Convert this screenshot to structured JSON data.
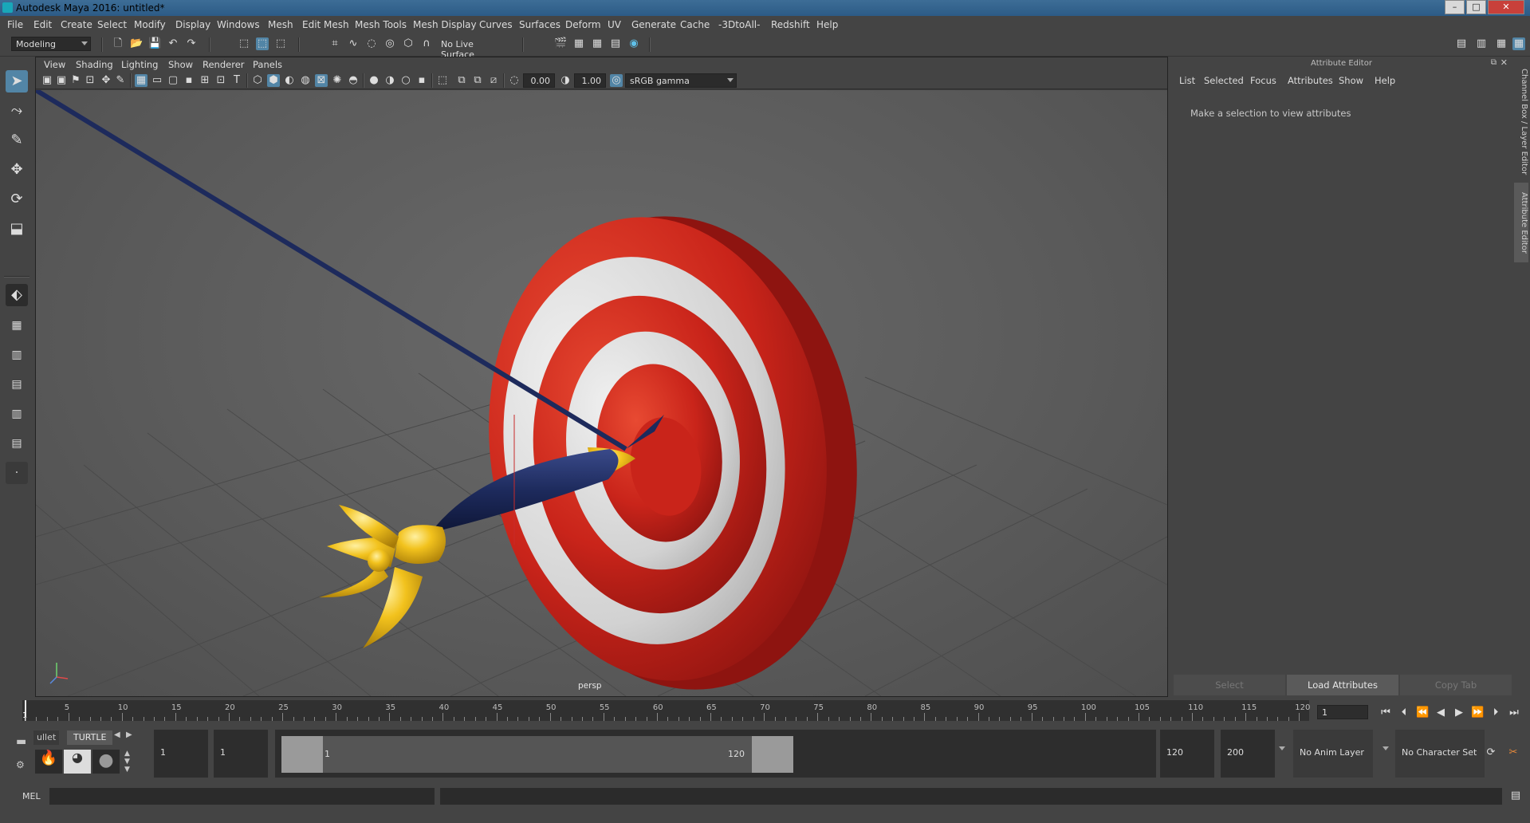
{
  "window": {
    "title": "Autodesk Maya 2016: untitled*"
  },
  "menubar": [
    "File",
    "Edit",
    "Create",
    "Select",
    "Modify",
    "Display",
    "Windows",
    "Mesh",
    "Edit Mesh",
    "Mesh Tools",
    "Mesh Display",
    "Curves",
    "Surfaces",
    "Deform",
    "UV",
    "Generate",
    "Cache",
    "-3DtoAll-",
    "Redshift",
    "Help"
  ],
  "statusline": {
    "workspace": "Modeling",
    "live_surface": "No Live Surface"
  },
  "panel": {
    "menu": [
      "View",
      "Shading",
      "Lighting",
      "Show",
      "Renderer",
      "Panels"
    ],
    "exposure": "0.00",
    "gamma": "1.00",
    "colorspace": "sRGB gamma",
    "camera_label": "persp"
  },
  "attribute_editor": {
    "title": "Attribute Editor",
    "menu": [
      "List",
      "Selected",
      "Focus",
      "Attributes",
      "Show",
      "Help"
    ],
    "message": "Make a selection to view attributes",
    "buttons": {
      "select": "Select",
      "load": "Load Attributes",
      "copy": "Copy Tab"
    }
  },
  "side_tabs": {
    "channel_box": "Channel Box / Layer Editor",
    "attribute_editor": "Attribute Editor"
  },
  "timeline": {
    "ticks": [
      "5",
      "10",
      "15",
      "20",
      "25",
      "30",
      "35",
      "40",
      "45",
      "50",
      "55",
      "60",
      "65",
      "70",
      "75",
      "80",
      "85",
      "90",
      "95",
      "100",
      "105",
      "110",
      "115",
      "120"
    ],
    "current_marker": "1",
    "current_frame": "1"
  },
  "shelf": {
    "tabs": [
      "ullet",
      "TURTLE"
    ]
  },
  "range": {
    "start": "1",
    "playback_start": "1",
    "slider_start": "1",
    "slider_end": "120",
    "playback_end": "120",
    "end": "200",
    "anim_layer": "No Anim Layer",
    "character_set": "No Character Set"
  },
  "command": {
    "label": "MEL"
  },
  "colors": {
    "target_red": "#d42a17",
    "target_white": "#d9d9d9",
    "dart_yellow": "#f2c21d",
    "dart_navy": "#1d2a5c"
  }
}
